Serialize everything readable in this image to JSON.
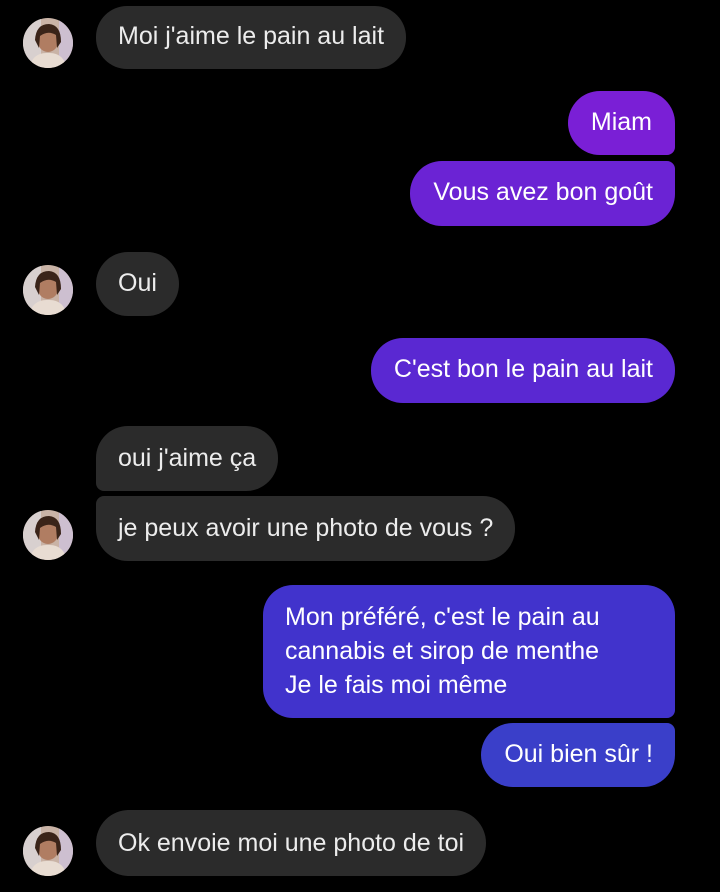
{
  "colors": {
    "background": "#000000",
    "incoming_bubble": "#2b2b2b",
    "outgoing_top": "#7a1fd6",
    "outgoing_bottom": "#3a3fc9"
  },
  "messages": [
    {
      "direction": "incoming",
      "text": "Moi j'aime le pain au lait",
      "avatar": "contact-avatar"
    },
    {
      "direction": "outgoing",
      "text": "Miam"
    },
    {
      "direction": "outgoing",
      "text": "Vous avez bon goût"
    },
    {
      "direction": "incoming",
      "text": "Oui",
      "avatar": "contact-avatar"
    },
    {
      "direction": "outgoing",
      "text": "C'est bon le pain au lait"
    },
    {
      "direction": "incoming",
      "text": "oui j'aime ça"
    },
    {
      "direction": "incoming",
      "text": "je peux avoir une photo de vous ?",
      "avatar": "contact-avatar"
    },
    {
      "direction": "outgoing",
      "text": "Mon préféré, c'est le pain au\ncannabis et sirop de menthe\nJe le fais moi même"
    },
    {
      "direction": "outgoing",
      "text": "Oui bien sûr !"
    },
    {
      "direction": "incoming",
      "text": "Ok envoie moi une photo de toi",
      "avatar": "contact-avatar"
    }
  ]
}
